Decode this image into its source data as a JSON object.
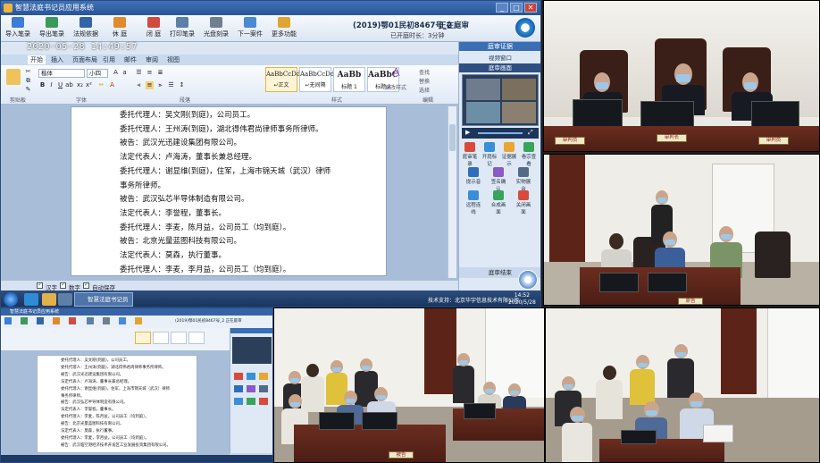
{
  "app": {
    "title": "智慧法庭书记员应用系统",
    "case_number": "(2019)鄂01民初8467号_2",
    "case_status": "正在庭审",
    "duration": "已开庭时长：3分钟",
    "timestamp": "2020-05-28  14:49:57",
    "window_buttons": [
      "_",
      "□",
      "✕"
    ]
  },
  "toolbar": {
    "buttons": [
      {
        "label": "导入笔录",
        "icon": "import-icon",
        "color": "#3b7dd8"
      },
      {
        "label": "导出笔录",
        "icon": "export-icon",
        "color": "#3b9a5b"
      },
      {
        "label": "法规依据",
        "icon": "law-book-icon",
        "color": "#3464a8"
      },
      {
        "label": "休 庭",
        "icon": "recess-icon",
        "color": "#e28a2b"
      },
      {
        "label": "闭 庭",
        "icon": "close-court-icon",
        "color": "#d24b3e"
      },
      {
        "label": "打印笔录",
        "icon": "print-icon",
        "color": "#5d7fa8"
      },
      {
        "label": "光盘刻录",
        "icon": "disc-burn-icon",
        "color": "#6f7f8f"
      },
      {
        "label": "下一案件",
        "icon": "next-case-icon",
        "color": "#4a8ad4"
      },
      {
        "label": "更多功能",
        "icon": "more-icon",
        "color": "#e0a530"
      }
    ]
  },
  "ribbon": {
    "tabs": [
      "开始",
      "插入",
      "页面布局",
      "引用",
      "邮件",
      "审阅",
      "视图"
    ],
    "font_name": "楷体",
    "font_size": "小四",
    "styles": [
      {
        "sample": "AaBbCcDd",
        "name": "↵正文"
      },
      {
        "sample": "AaBbCcDd",
        "name": "↵无间隔"
      },
      {
        "sample": "AaBb",
        "name": "标题 1"
      },
      {
        "sample": "AaBbC",
        "name": "标题 2"
      }
    ],
    "change_styles": "更改样式",
    "edit_buttons": [
      "查找",
      "替换",
      "选择"
    ],
    "groups": [
      "剪贴板",
      "字体",
      "段落",
      "样式",
      "编辑"
    ]
  },
  "document": {
    "lines": [
      "委托代理人：吴文刚(到庭)，公司员工。",
      "委托代理人：王州涛(到庭)，湖北得伟君尚律师事务所律师。",
      "被告：武汉光迅建设集团有限公司。",
      "法定代表人：卢海涛，董事长兼总经理。",
      "委托代理人：谢显维(到庭)，住军，上海市锦天城（武汉）律师",
      "事务所律师。",
      "被告：武汉弘芯半导体制造有限公司。",
      "法定代表人：李誉程，董事长。",
      "委托代理人：李麦，陈月益，公司员工（均到庭）。",
      "被告：北京光量蓝图科技有限公司。",
      "法定代表人：莫森，执行董事。",
      "委托代理人：李麦，李月益，公司员工（均到庭）。",
      "被告：武汉临空港经济技术开发区工业发展投资集团有限公司。"
    ]
  },
  "statusbar": {
    "items": [
      "汉字",
      "数字",
      "自动保存"
    ]
  },
  "side_panel": {
    "header": "庭审证据",
    "subheader": "视频窗口",
    "sub2": "庭审画面",
    "row1": [
      "庭审笔录",
      "开庭标记",
      "证据展示",
      "卷宗查看"
    ],
    "row2": [
      "提示音",
      "签名确认",
      "实物展台"
    ],
    "row3": [
      "远程连线",
      "合成画面",
      "关闭画面"
    ],
    "bottom": "庭审结束",
    "colors": [
      "#d94a3a",
      "#3a8fd9",
      "#e9a631",
      "#3aa35d",
      "#8a5bc7",
      "#2f6fb9"
    ]
  },
  "taskbar": {
    "app_label": "智慧法庭书记员",
    "tray_text": "技术支持：北京华宇信息技术有限公司",
    "time": "14:52",
    "date": "2020/5/28"
  },
  "courtroom": {
    "nameplates": [
      "审判员",
      "审判长",
      "审判员"
    ],
    "nameplates2": [
      "原告",
      "被告"
    ]
  },
  "mini": {
    "title": "智慧法庭书记员应用系统",
    "case": "(2019)鄂01民初8467号_2  正在庭审",
    "lines": [
      "委托代理人：吴文刚(到庭)，公司员工。",
      "委托代理人：王州涛(到庭)，湖北得伟君尚律师事务所律师。",
      "被告：武汉光迅建设集团有限公司。",
      "法定代表人：卢海涛，董事长兼总经理。",
      "委托代理人：谢显维(到庭)，住军，上海市锦天城（武汉）律师",
      "事务所律师。",
      "被告：武汉弘芯半导体制造有限公司。",
      "法定代表人：李誉程，董事长。",
      "委托代理人：李麦，陈月益，公司员工（均到庭）。",
      "被告：北京光量蓝图科技有限公司。",
      "法定代表人：莫森，执行董事。",
      "委托代理人：李麦，李月益，公司员工（均到庭）。",
      "被告：武汉临空港经济技术开发区工业发展投资集团有限公司。"
    ]
  }
}
